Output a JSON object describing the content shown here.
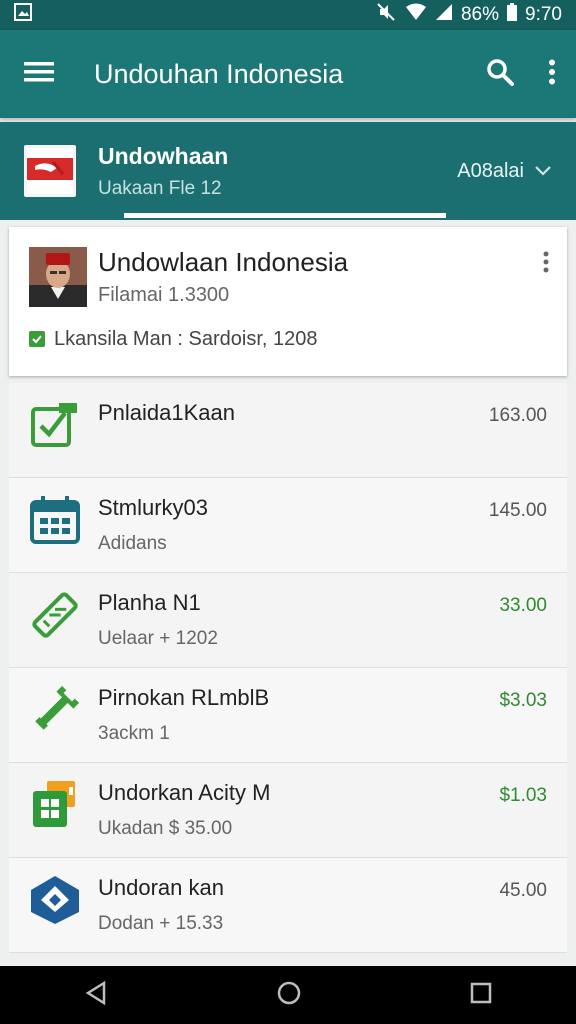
{
  "status_bar": {
    "battery": "86%",
    "time": "9:70"
  },
  "app_bar": {
    "title": "Undouhan Indonesia",
    "icons": [
      "menu-icon",
      "search-icon",
      "more-vert-icon"
    ]
  },
  "header": {
    "title": "Undowhaan",
    "subtitle": "Uakaan Fle 12",
    "dropdown_label": "A08alai"
  },
  "profile": {
    "name": "Undowlaan Indonesia",
    "subtitle": "Filamai 1.3300",
    "meta": "Lkansila Man : Sardoisr, 1208"
  },
  "items": [
    {
      "title": "Pnlaida1Kaan",
      "subtitle": "",
      "amount": "163.00",
      "amount_color": "#555555",
      "icon": "task-check-icon"
    },
    {
      "title": "Stmlurky03",
      "subtitle": "Adidans",
      "amount": "145.00",
      "amount_color": "#555555",
      "icon": "calendar-icon"
    },
    {
      "title": "Planha N1",
      "subtitle": "Uelaar + 1202",
      "amount": "33.00",
      "amount_color": "#2f8a2f",
      "icon": "ticket-icon"
    },
    {
      "title": "Pirnokan RLmblB",
      "subtitle": "3ackm 1",
      "amount": "$3.03",
      "amount_color": "#2f8a2f",
      "icon": "wrench-icon"
    },
    {
      "title": "Undorkan Acity M",
      "subtitle": "Ukadan $ 35.00",
      "amount": "$1.03",
      "amount_color": "#2f8a2f",
      "icon": "package-icon"
    },
    {
      "title": "Undoran kan",
      "subtitle": "Dodan + 15.33",
      "amount": "45.00",
      "amount_color": "#555555",
      "icon": "blue-diamond-icon"
    }
  ],
  "colors": {
    "primary": "#1c7777",
    "primary_dark": "#15605f",
    "green": "#2f8a2f",
    "blue": "#1f5d99"
  }
}
